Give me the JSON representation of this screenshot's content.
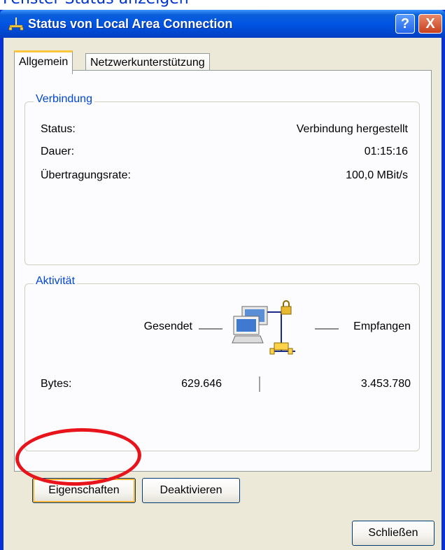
{
  "background_caption": "Fenster Status anzeigen",
  "window": {
    "title": "Status von Local Area Connection",
    "help_button": "?",
    "close_button": "X"
  },
  "tabs": [
    {
      "label": "Allgemein",
      "active": true
    },
    {
      "label": "Netzwerkunterstützung",
      "active": false
    }
  ],
  "connection": {
    "title": "Verbindung",
    "rows": [
      {
        "label": "Status:",
        "value": "Verbindung hergestellt"
      },
      {
        "label": "Dauer:",
        "value": "01:15:16"
      },
      {
        "label": "Übertragungsrate:",
        "value": "100,0 MBit/s"
      }
    ]
  },
  "activity": {
    "title": "Aktivität",
    "sent_label": "Gesendet",
    "received_label": "Empfangen",
    "bytes_label": "Bytes:",
    "bytes_sent": "629.646",
    "bytes_received": "3.453.780"
  },
  "buttons": {
    "properties": "Eigenschaften",
    "disable": "Deaktivieren",
    "close": "Schließen"
  },
  "colors": {
    "titlebar": "#0054e3",
    "dialog_bg": "#ece9d8",
    "group_title": "#0046d5",
    "annotation": "#e8141c"
  }
}
